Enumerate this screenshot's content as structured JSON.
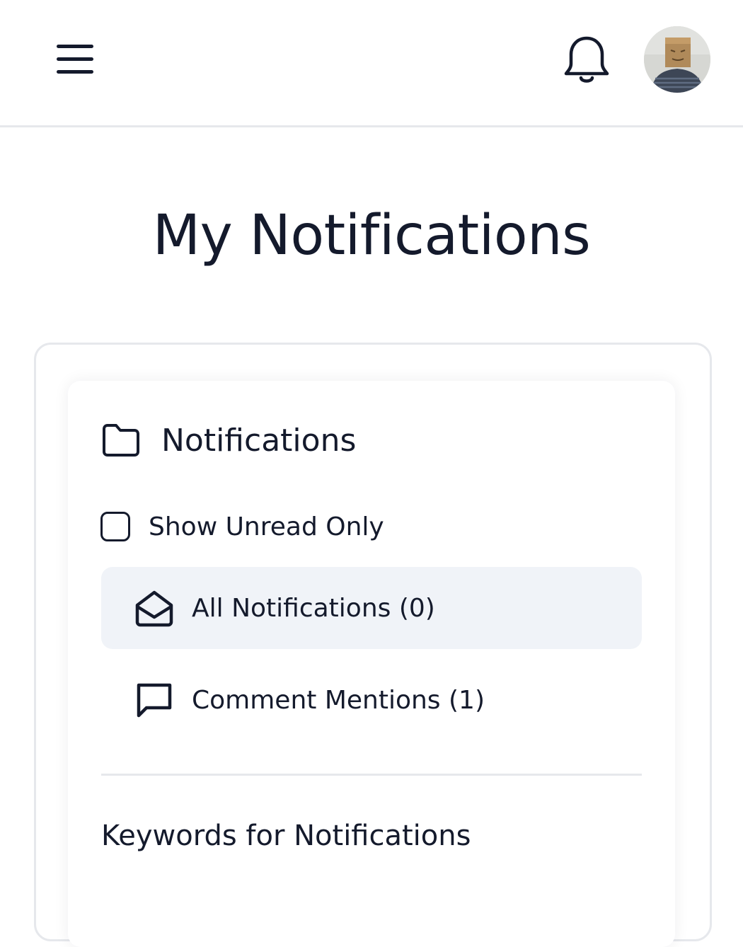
{
  "header": {
    "menu_icon": "hamburger-menu-icon",
    "notifications_icon": "bell-icon",
    "avatar_icon": "user-avatar"
  },
  "page": {
    "title": "My Notifications"
  },
  "notifications_panel": {
    "section_title": "Notifications",
    "section_icon": "folder-icon",
    "show_unread_only": {
      "label": "Show Unread Only",
      "checked": false
    },
    "items": [
      {
        "label": "All Notifications (0)",
        "icon": "envelope-open-icon",
        "active": true
      },
      {
        "label": "Comment Mentions (1)",
        "icon": "chat-bubble-icon",
        "active": false
      }
    ],
    "keywords_title": "Keywords for Notifications"
  },
  "colors": {
    "text": "#141a2c",
    "active_item_bg": "#f0f3f8",
    "border": "#e6e8ec"
  }
}
